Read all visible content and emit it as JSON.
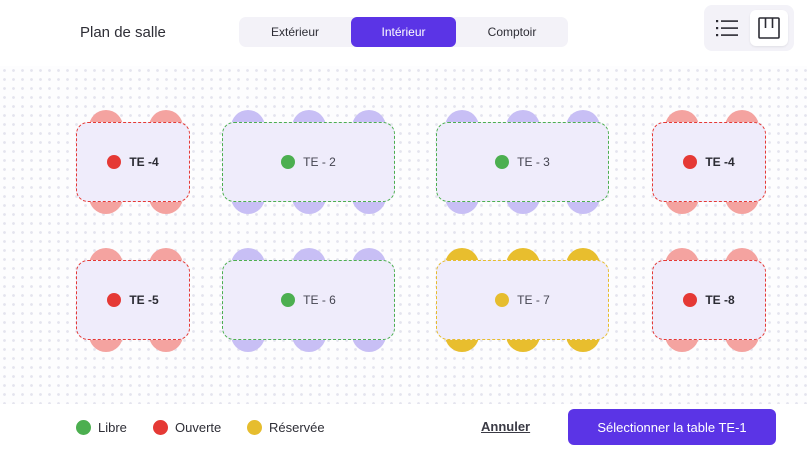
{
  "header": {
    "title": "Plan de salle",
    "tabs": [
      {
        "label": "Extérieur",
        "active": false
      },
      {
        "label": "Intérieur",
        "active": true
      },
      {
        "label": "Comptoir",
        "active": false
      }
    ],
    "view_toggle": {
      "list_icon": "list-icon",
      "plan_icon": "floor-plan-icon",
      "selected": "plan"
    }
  },
  "colors": {
    "accent": "#5b34e6",
    "libre": "#4caf50",
    "ouverte": "#e53935",
    "reservee": "#e6bd2e",
    "chair_libre": "#c8bff5",
    "chair_ouverte": "#f4a3a0",
    "chair_reservee": "#e8be2e"
  },
  "tables": [
    {
      "label": "TE -4",
      "status": "ouverte"
    },
    {
      "label": "TE - 2",
      "status": "libre"
    },
    {
      "label": "TE - 3",
      "status": "libre"
    },
    {
      "label": "TE -4",
      "status": "ouverte"
    },
    {
      "label": "TE -5",
      "status": "ouverte"
    },
    {
      "label": "TE - 6",
      "status": "libre"
    },
    {
      "label": "TE - 7",
      "status": "reservee"
    },
    {
      "label": "TE -8",
      "status": "ouverte"
    }
  ],
  "legend": [
    {
      "label": "Libre",
      "status": "libre"
    },
    {
      "label": "Ouverte",
      "status": "ouverte"
    },
    {
      "label": "Réservée",
      "status": "reservee"
    }
  ],
  "footer": {
    "cancel_label": "Annuler",
    "select_label": "Sélectionner la table TE-1"
  }
}
